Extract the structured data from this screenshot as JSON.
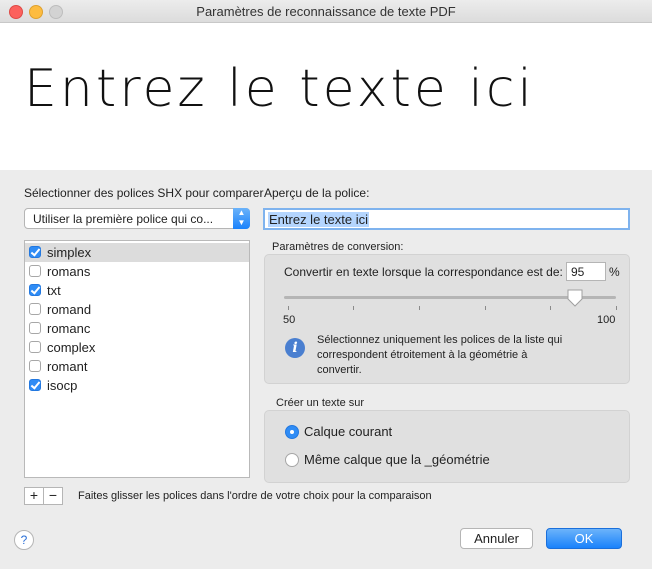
{
  "window": {
    "title": "Paramètres de reconnaissance de texte PDF"
  },
  "preview": {
    "text": "Entrez le texte ici"
  },
  "left": {
    "select_label": "Sélectionner des polices SHX pour comparer",
    "popup_value": "Utiliser la première police qui co...",
    "fonts": [
      {
        "name": "simplex",
        "checked": true,
        "selected": true
      },
      {
        "name": "romans",
        "checked": false,
        "selected": false
      },
      {
        "name": "txt",
        "checked": true,
        "selected": false
      },
      {
        "name": "romand",
        "checked": false,
        "selected": false
      },
      {
        "name": "romanc",
        "checked": false,
        "selected": false
      },
      {
        "name": "complex",
        "checked": false,
        "selected": false
      },
      {
        "name": "romant",
        "checked": false,
        "selected": false
      },
      {
        "name": "isocp",
        "checked": true,
        "selected": false
      }
    ],
    "add_label": "+",
    "remove_label": "−",
    "drag_hint": "Faites glisser les polices dans l'ordre de votre choix pour la comparaison"
  },
  "right": {
    "font_preview_label": "Aperçu de la police:",
    "font_preview_value": "Entrez le texte ici",
    "conversion": {
      "label": "Paramètres de conversion:",
      "threshold_label": "Convertir en texte lorsque la correspondance est de:",
      "threshold_value": "95",
      "percent": "%",
      "slider_min": "50",
      "slider_max": "100",
      "slider_value": 95,
      "info": "Sélectionnez uniquement les polices de la liste qui correspondent étroitement à la géométrie à convertir."
    },
    "create": {
      "label": "Créer un texte sur",
      "options": [
        {
          "label": "Calque courant",
          "selected": true
        },
        {
          "label": "Même calque que la _géométrie",
          "selected": false
        }
      ]
    }
  },
  "footer": {
    "help": "?",
    "cancel": "Annuler",
    "ok": "OK"
  }
}
